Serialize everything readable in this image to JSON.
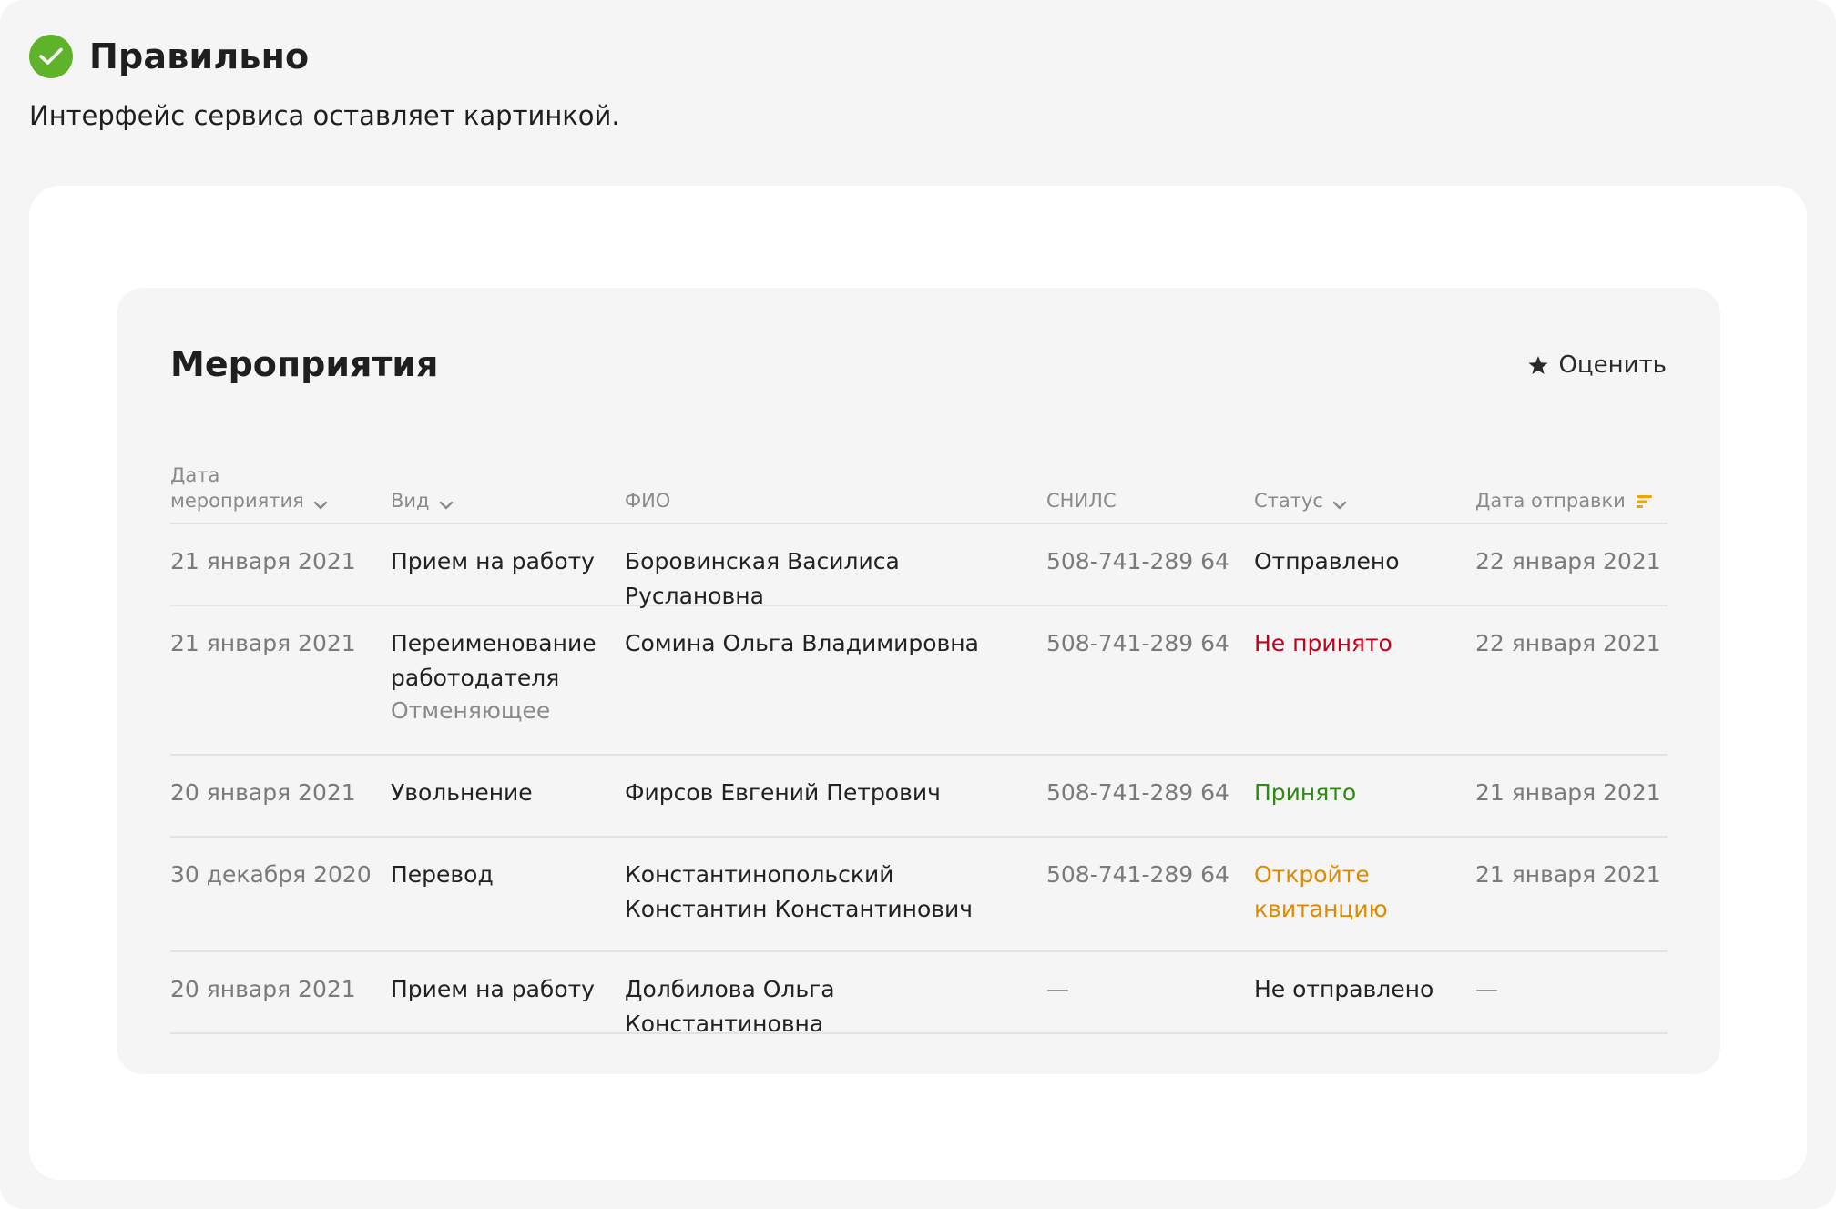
{
  "verdict": {
    "title": "Правильно",
    "subtitle": "Интерфейс сервиса оставляет картинкой.",
    "icon": "check-circle-icon",
    "color": "#5fb32a"
  },
  "panel": {
    "title": "Мероприятия",
    "rate_label": "Оценить",
    "rate_icon": "star-icon"
  },
  "table": {
    "headers": {
      "date_line1": "Дата",
      "date_line2": "мероприятия",
      "kind": "Вид",
      "fio": "ФИО",
      "snils": "СНИЛС",
      "status": "Статус",
      "sent": "Дата отправки"
    },
    "rows": [
      {
        "date": "21 января 2021",
        "kind": "Прием на работу",
        "kind_sub": "",
        "fio": "Боровинская Василиса Руслановна",
        "snils": "508-741-289 64",
        "status": "Отправлено",
        "sent": "22 января 2021"
      },
      {
        "date": "21 января 2021",
        "kind": "Переименование работодателя",
        "kind_sub": "Отменяющее",
        "fio": "Сомина Ольга Владимировна",
        "snils": "508-741-289 64",
        "status": "Не принято",
        "sent": "22 января 2021"
      },
      {
        "date": "20 января 2021",
        "kind": "Увольнение",
        "kind_sub": "",
        "fio": "Фирсов Евгений Петрович",
        "snils": "508-741-289 64",
        "status": "Принято",
        "sent": "21 января 2021"
      },
      {
        "date": "30 декабря 2020",
        "kind": "Перевод",
        "kind_sub": "",
        "fio": "Константинопольский Константин Константинович",
        "snils": "508-741-289 64",
        "status": "Откройте квитанцию",
        "sent": "21 января 2021"
      },
      {
        "date": "20 января 2021",
        "kind": "Прием на работу",
        "kind_sub": "",
        "fio": "Долбилова Ольга Константиновна",
        "snils": "—",
        "status": "Не отправлено",
        "sent": "—"
      }
    ]
  },
  "colors": {
    "status_rejected": "#c4001d",
    "status_accepted": "#2f8a12",
    "status_open": "#e08a00",
    "sort_icon": "#f5a200"
  }
}
